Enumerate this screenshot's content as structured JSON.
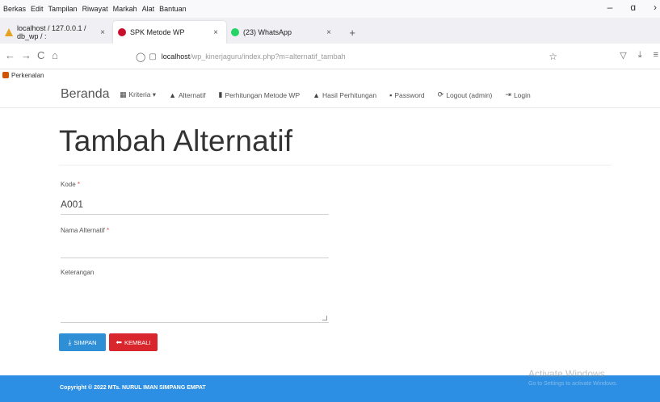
{
  "menubar": {
    "items": [
      "Berkas",
      "Edit",
      "Tampilan",
      "Riwayat",
      "Markah",
      "Alat",
      "Bantuan"
    ],
    "controls": {
      "minimize": "–",
      "maximize": "ɑ",
      "close": "›"
    }
  },
  "tabs": [
    {
      "title": "localhost / 127.0.0.1 / db_wp / :",
      "close": "×",
      "icon": "database-icon"
    },
    {
      "title": "SPK Metode WP",
      "close": "×",
      "icon": "app-icon"
    },
    {
      "title": "(23) WhatsApp",
      "close": "×",
      "icon": "whatsapp-icon"
    }
  ],
  "newtab": "+",
  "navbar": {
    "back": "←",
    "forward": "→",
    "reload": "C",
    "home": "⌂",
    "url_host": "localhost",
    "url_path": "/wp_kinerjaguru/index.php?m=alternatif_tambah",
    "bookmark": "☆",
    "pocket": "▽",
    "download": "⤓",
    "menu": "≡"
  },
  "bookmarks": {
    "item": "Perkenalan"
  },
  "site": {
    "brand": "Beranda",
    "links": [
      {
        "icon": "▦",
        "label": "Kriteria ▾"
      },
      {
        "icon": "▲",
        "label": "Alternatif"
      },
      {
        "icon": "▮",
        "label": "Perhitungan Metode WP"
      },
      {
        "icon": "▲",
        "label": "Hasil Perhitungan"
      },
      {
        "icon": "▪",
        "label": "Password"
      },
      {
        "icon": "⟳",
        "label": "Logout (admin)"
      },
      {
        "icon": "⇥",
        "label": "Login"
      }
    ]
  },
  "form": {
    "title": "Tambah Alternatif",
    "kode_label": "Kode",
    "kode_value": "A001",
    "nama_label": "Nama Alternatif",
    "nama_value": "",
    "ket_label": "Keterangan",
    "ket_value": "",
    "required_mark": "*",
    "simpan_label": "SIMPAN",
    "simpan_icon": "⤓",
    "kembali_label": "KEMBALI",
    "kembali_icon": "⬅"
  },
  "footer": {
    "copyright": "Copyright © 2022 MTs. NURUL IMAN SIMPANG EMPAT"
  },
  "watermark": {
    "line1": "Activate Windows",
    "line2": "Go to Settings to activate Windows."
  },
  "colors": {
    "primary": "#2e8fd6",
    "danger": "#d9262c",
    "footer": "#2d8fe3"
  }
}
